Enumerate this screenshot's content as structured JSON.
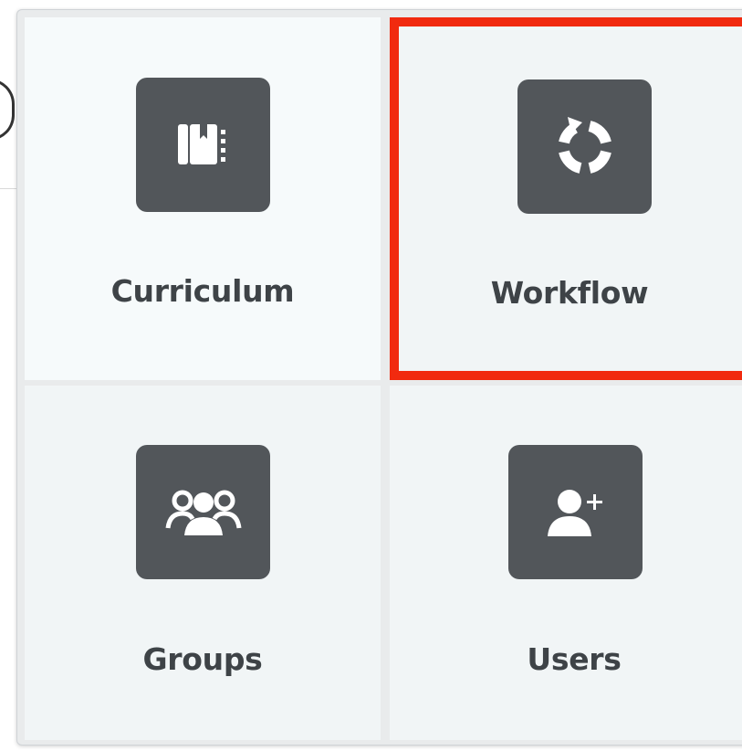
{
  "tiles": [
    {
      "id": "curriculum",
      "label": "Curriculum",
      "icon": "curriculum-notebook-icon",
      "highlighted": false
    },
    {
      "id": "workflow",
      "label": "Workflow",
      "icon": "workflow-cycle-icon",
      "highlighted": true
    },
    {
      "id": "groups",
      "label": "Groups",
      "icon": "groups-people-icon",
      "highlighted": false
    },
    {
      "id": "users",
      "label": "Users",
      "icon": "add-user-icon",
      "highlighted": false
    }
  ],
  "colors": {
    "icon_box": "#52565a",
    "label_text": "#3e4347",
    "tile_background": "#f1f5f6",
    "highlight_border": "#f12a0f"
  }
}
